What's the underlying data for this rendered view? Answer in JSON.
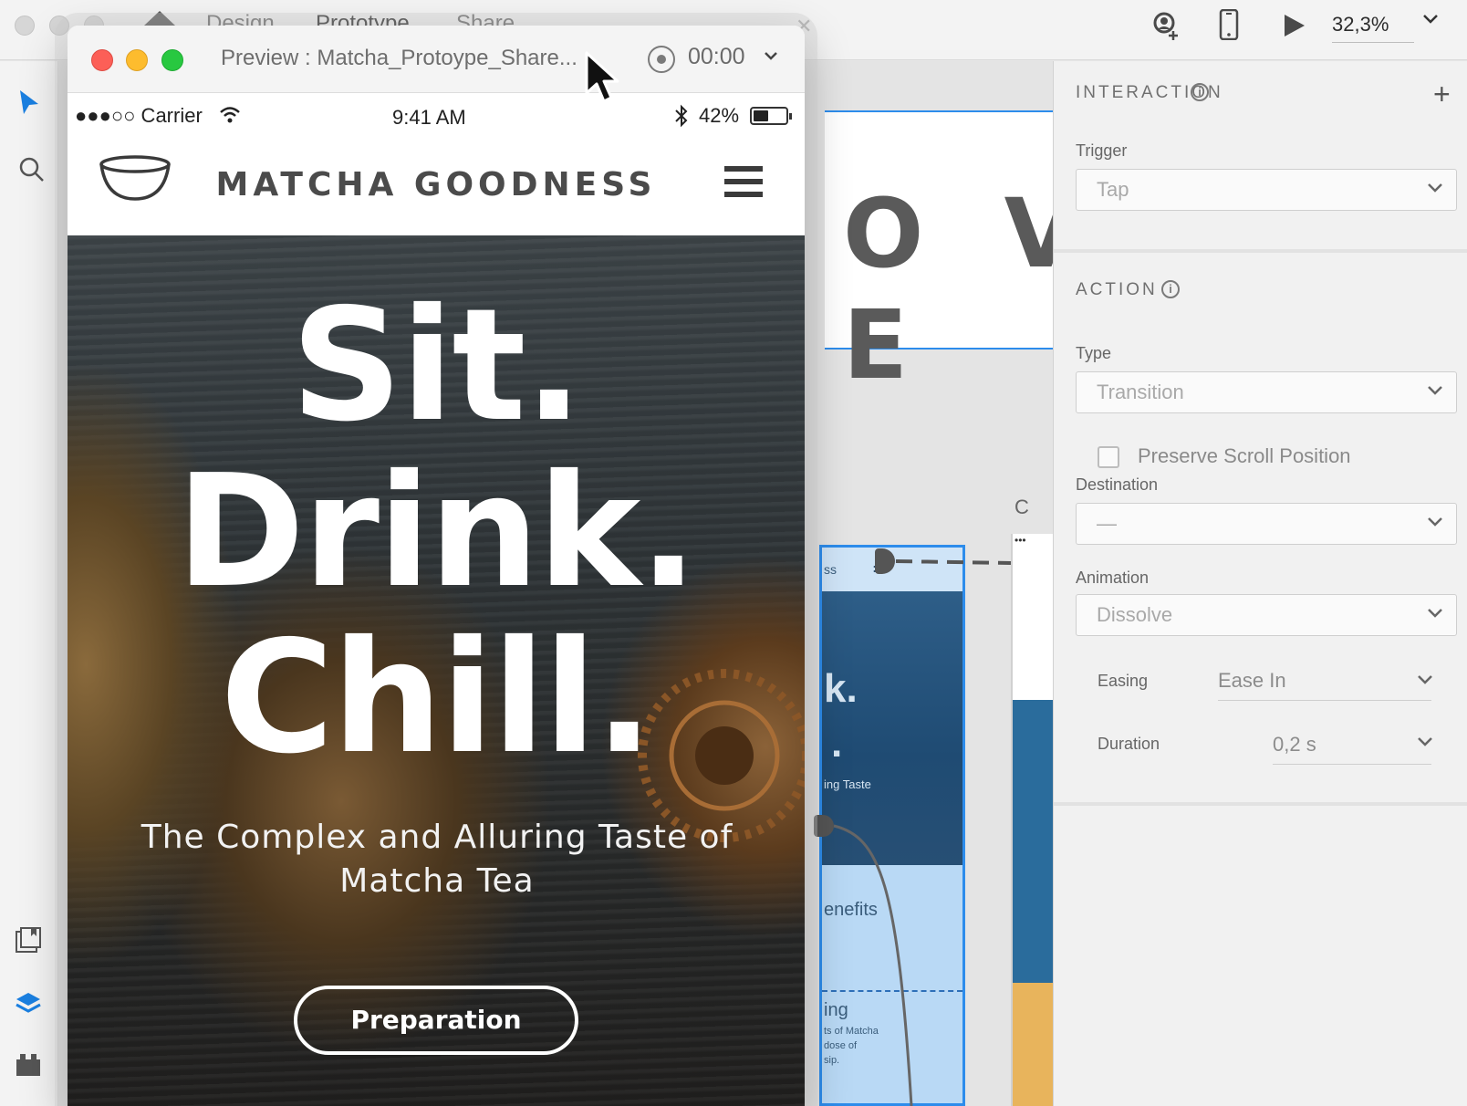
{
  "app": {
    "tabs": [
      "Design",
      "Prototype",
      "Share"
    ],
    "active_tab": "Prototype",
    "zoom": "32,3%"
  },
  "preview": {
    "title": "Preview : Matcha_Protoype_Share...",
    "record_time": "00:00"
  },
  "phone": {
    "carrier": "●●●○○ Carrier",
    "time": "9:41 AM",
    "battery": "42%",
    "battery_level": 0.42
  },
  "site": {
    "brand": "MATCHA GOODNESS",
    "hero_lines": [
      "Sit.",
      "Drink.",
      "Chill."
    ],
    "subtitle": "The Complex and Alluring Taste of Matcha Tea",
    "cta": "Preparation"
  },
  "canvas": {
    "artboard_text": "O V E",
    "mini_board_texts": [
      "ss",
      "k.",
      ".",
      "ing Taste",
      "enefits",
      "ing",
      "ts of Matcha",
      "dose of",
      "sip."
    ],
    "side_label": "C"
  },
  "panel": {
    "interaction_title": "INTERACTION",
    "trigger_label": "Trigger",
    "trigger_value": "Tap",
    "action_title": "ACTION",
    "type_label": "Type",
    "type_value": "Transition",
    "preserve_scroll_label": "Preserve Scroll Position",
    "preserve_scroll_checked": false,
    "destination_label": "Destination",
    "destination_value": "—",
    "animation_label": "Animation",
    "animation_value": "Dissolve",
    "easing_label": "Easing",
    "easing_value": "Ease In",
    "duration_label": "Duration",
    "duration_value": "0,2 s"
  },
  "icons": {
    "select": "pointer-arrow-icon",
    "search": "search-icon",
    "assets": "assets-icon",
    "layers": "layers-icon",
    "plugins": "plugins-icon",
    "share_user": "add-user-icon",
    "device": "mobile-device-icon",
    "play": "play-icon"
  },
  "colors": {
    "accent": "#2d8ceb",
    "close": "#fc5f57",
    "minimize": "#fdbc2e",
    "maximize": "#28c840"
  }
}
